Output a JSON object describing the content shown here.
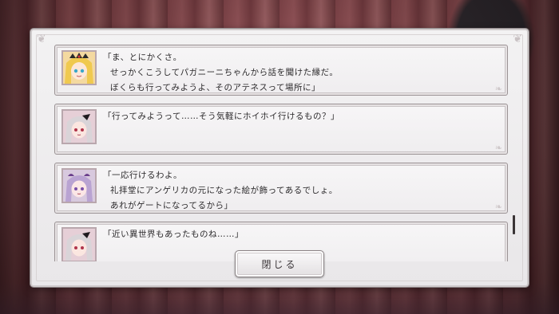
{
  "log": {
    "entries": [
      {
        "speaker_icon": "blonde-girl-portrait-icon",
        "lines": [
          "「ま、とにかくさ。",
          "せっかくこうしてパガニーニちゃんから話を聞けた縁だ。",
          "ぼくらも行ってみようよ、そのアテネスって場所に」"
        ]
      },
      {
        "speaker_icon": "silver-hair-girl-portrait-icon",
        "lines": [
          "「行ってみようって……そう気軽にホイホイ行けるもの？」"
        ]
      },
      {
        "speaker_icon": "lavender-hair-girl-portrait-icon",
        "lines": [
          "「一応行けるわよ。",
          "礼拝堂にアンゲリカの元になった絵が飾ってあるでしょ。",
          "あれがゲートになってるから」"
        ]
      },
      {
        "speaker_icon": "silver-hair-girl-portrait-icon",
        "lines": [
          "「近い異世界もあったものね……」"
        ]
      }
    ]
  },
  "buttons": {
    "close_label": "閉じる"
  },
  "colors": {
    "panel": "#efedef",
    "panel_border": "#9b9395",
    "text": "#2c2a2c",
    "backdrop": "#7b3338"
  }
}
